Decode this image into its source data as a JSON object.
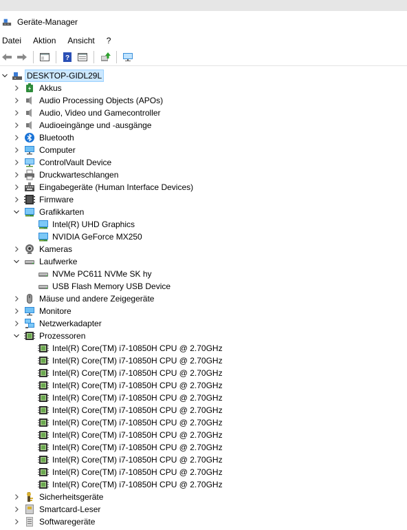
{
  "window": {
    "title": "Geräte-Manager"
  },
  "menu": [
    "Datei",
    "Aktion",
    "Ansicht",
    "?"
  ],
  "toolbar": [
    "back-icon",
    "forward-icon",
    "properties-icon",
    "help-icon",
    "view-icon",
    "update-driver-icon",
    "monitor-scan-icon"
  ],
  "tree": {
    "root": "DESKTOP-GIDL29L",
    "categories": [
      {
        "label": "Akkus",
        "icon": "battery",
        "expanded": false,
        "children": []
      },
      {
        "label": "Audio Processing Objects (APOs)",
        "icon": "speaker",
        "expanded": false,
        "children": []
      },
      {
        "label": "Audio, Video und Gamecontroller",
        "icon": "speaker",
        "expanded": false,
        "children": []
      },
      {
        "label": "Audioeingänge und -ausgänge",
        "icon": "speaker",
        "expanded": false,
        "children": []
      },
      {
        "label": "Bluetooth",
        "icon": "bluetooth",
        "expanded": false,
        "children": []
      },
      {
        "label": "Computer",
        "icon": "monitor",
        "expanded": false,
        "children": []
      },
      {
        "label": "ControlVault Device",
        "icon": "monitor-net",
        "expanded": false,
        "children": []
      },
      {
        "label": "Druckwarteschlangen",
        "icon": "printer",
        "expanded": false,
        "children": []
      },
      {
        "label": "Eingabegeräte (Human Interface Devices)",
        "icon": "hid",
        "expanded": false,
        "children": []
      },
      {
        "label": "Firmware",
        "icon": "chip-dark",
        "expanded": false,
        "children": []
      },
      {
        "label": "Grafikkarten",
        "icon": "display-adapter",
        "expanded": true,
        "children": [
          {
            "label": "Intel(R) UHD Graphics",
            "icon": "display-adapter"
          },
          {
            "label": "NVIDIA GeForce MX250",
            "icon": "display-adapter"
          }
        ]
      },
      {
        "label": "Kameras",
        "icon": "camera",
        "expanded": false,
        "children": []
      },
      {
        "label": "Laufwerke",
        "icon": "drive",
        "expanded": true,
        "children": [
          {
            "label": "NVMe PC611 NVMe SK hy",
            "icon": "drive"
          },
          {
            "label": "USB Flash Memory USB Device",
            "icon": "drive"
          }
        ]
      },
      {
        "label": "Mäuse und andere Zeigegeräte",
        "icon": "mouse",
        "expanded": false,
        "children": []
      },
      {
        "label": "Monitore",
        "icon": "monitor",
        "expanded": false,
        "children": []
      },
      {
        "label": "Netzwerkadapter",
        "icon": "network",
        "expanded": false,
        "children": []
      },
      {
        "label": "Prozessoren",
        "icon": "cpu",
        "expanded": true,
        "children": [
          {
            "label": "Intel(R) Core(TM) i7-10850H CPU @ 2.70GHz",
            "icon": "cpu"
          },
          {
            "label": "Intel(R) Core(TM) i7-10850H CPU @ 2.70GHz",
            "icon": "cpu"
          },
          {
            "label": "Intel(R) Core(TM) i7-10850H CPU @ 2.70GHz",
            "icon": "cpu"
          },
          {
            "label": "Intel(R) Core(TM) i7-10850H CPU @ 2.70GHz",
            "icon": "cpu"
          },
          {
            "label": "Intel(R) Core(TM) i7-10850H CPU @ 2.70GHz",
            "icon": "cpu"
          },
          {
            "label": "Intel(R) Core(TM) i7-10850H CPU @ 2.70GHz",
            "icon": "cpu"
          },
          {
            "label": "Intel(R) Core(TM) i7-10850H CPU @ 2.70GHz",
            "icon": "cpu"
          },
          {
            "label": "Intel(R) Core(TM) i7-10850H CPU @ 2.70GHz",
            "icon": "cpu"
          },
          {
            "label": "Intel(R) Core(TM) i7-10850H CPU @ 2.70GHz",
            "icon": "cpu"
          },
          {
            "label": "Intel(R) Core(TM) i7-10850H CPU @ 2.70GHz",
            "icon": "cpu"
          },
          {
            "label": "Intel(R) Core(TM) i7-10850H CPU @ 2.70GHz",
            "icon": "cpu"
          },
          {
            "label": "Intel(R) Core(TM) i7-10850H CPU @ 2.70GHz",
            "icon": "cpu"
          }
        ]
      },
      {
        "label": "Sicherheitsgeräte",
        "icon": "security",
        "expanded": false,
        "children": []
      },
      {
        "label": "Smartcard-Leser",
        "icon": "smartcard",
        "expanded": false,
        "children": []
      },
      {
        "label": "Softwaregeräte",
        "icon": "software",
        "expanded": false,
        "children": []
      }
    ]
  },
  "colors": {
    "selection_bg": "#cce8ff",
    "selection_border": "#99d1ff",
    "topstrip": "#e6e6e6"
  }
}
